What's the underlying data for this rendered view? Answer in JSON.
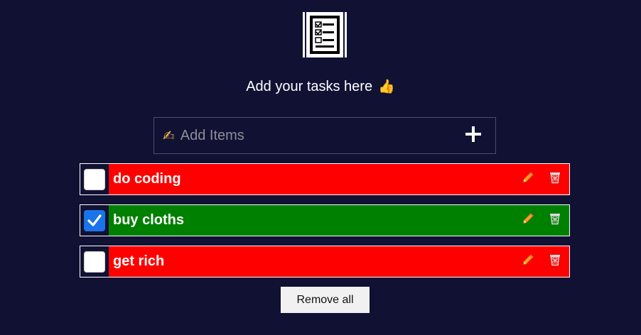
{
  "header": {
    "logo_icon": "checklist-icon",
    "title": "Add your tasks here",
    "title_emoji": "👍"
  },
  "add_item": {
    "hand_emoji": "✍",
    "placeholder": "Add Items",
    "value": "",
    "add_icon": "plus-icon"
  },
  "colors": {
    "background": "#111134",
    "incomplete": "#ff0000",
    "complete": "#008000",
    "checkbox_checked": "#1a73e8"
  },
  "tasks": [
    {
      "label": "do coding",
      "completed": false,
      "edit_icon": "pencil-icon",
      "delete_icon": "trash-icon"
    },
    {
      "label": "buy cloths",
      "completed": true,
      "edit_icon": "pencil-icon",
      "delete_icon": "trash-icon"
    },
    {
      "label": "get rich",
      "completed": false,
      "edit_icon": "pencil-icon",
      "delete_icon": "trash-icon"
    }
  ],
  "footer": {
    "remove_all_label": "Remove all"
  }
}
